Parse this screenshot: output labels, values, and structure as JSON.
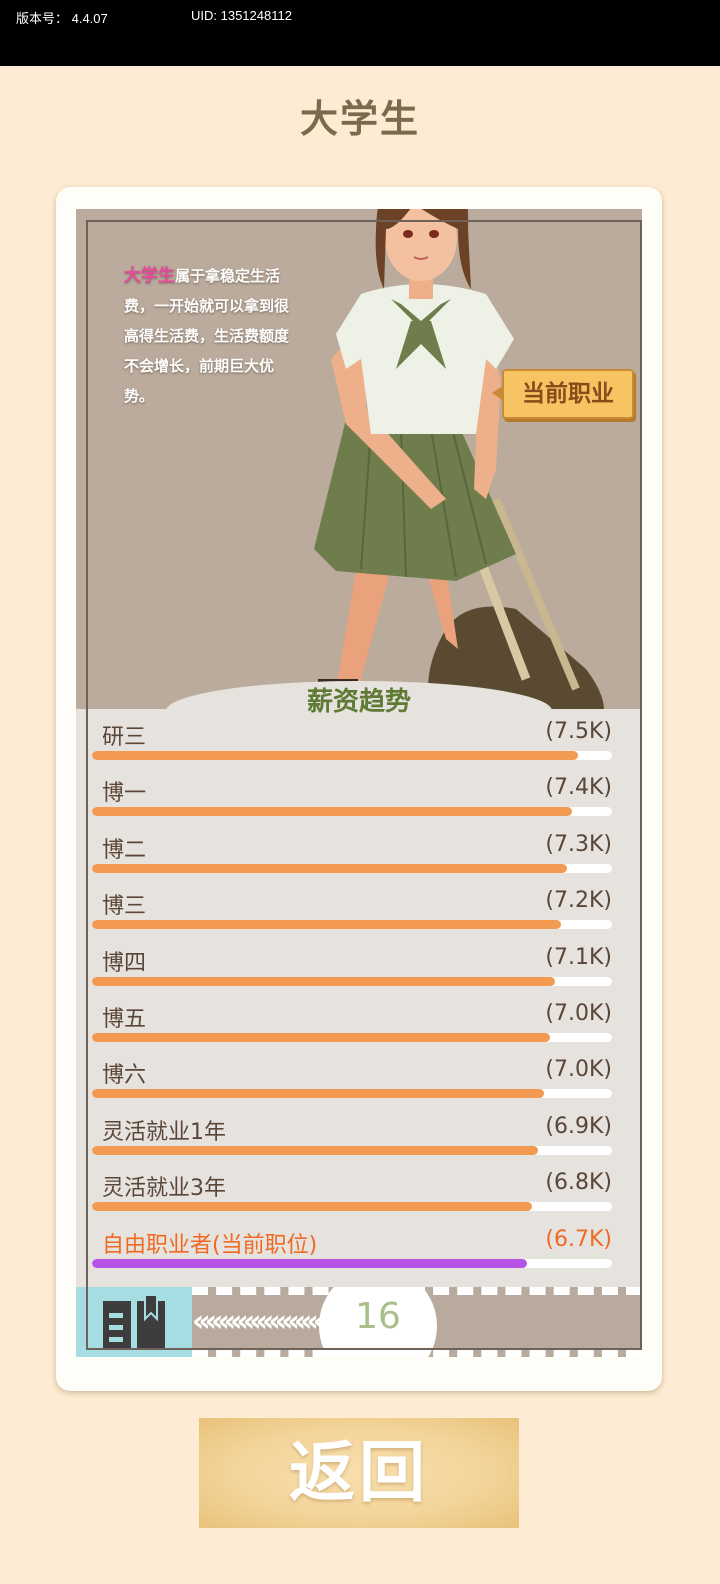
{
  "status_bar": {
    "version": "版本号： 4.4.07",
    "uid": "UID: 1351248112"
  },
  "job": {
    "title": "大学生",
    "desc_highlight": "大学生",
    "desc_text": "属于拿稳定生活费，一开始就可以拿到很高得生活费，生活费额度不会增长，前期巨大优势。",
    "current_badge": "当前职业"
  },
  "salary": {
    "title": "薪资趋势",
    "rows": [
      {
        "name": "研三",
        "value": "(7.5K)",
        "level": 0.935
      },
      {
        "name": "博一",
        "value": "(7.4K)",
        "level": 0.924
      },
      {
        "name": "博二",
        "value": "(7.3K)",
        "level": 0.913
      },
      {
        "name": "博三",
        "value": "(7.2K)",
        "level": 0.902
      },
      {
        "name": "博四",
        "value": "(7.1K)",
        "level": 0.891
      },
      {
        "name": "博五",
        "value": "(7.0K)",
        "level": 0.88
      },
      {
        "name": "博六",
        "value": "(7.0K)",
        "level": 0.869
      },
      {
        "name": "灵活就业1年",
        "value": "(6.9K)",
        "level": 0.858
      },
      {
        "name": "灵活就业3年",
        "value": "(6.8K)",
        "level": 0.847
      },
      {
        "name": "自由职业者(当前职位)",
        "value": "(6.7K)",
        "level": 0.836,
        "current": true
      }
    ]
  },
  "page_number": "16",
  "back_button": "返回",
  "colors": {
    "bar": "#f29a52",
    "bar_current": "#b653e6",
    "current_text": "#ef6a24"
  }
}
